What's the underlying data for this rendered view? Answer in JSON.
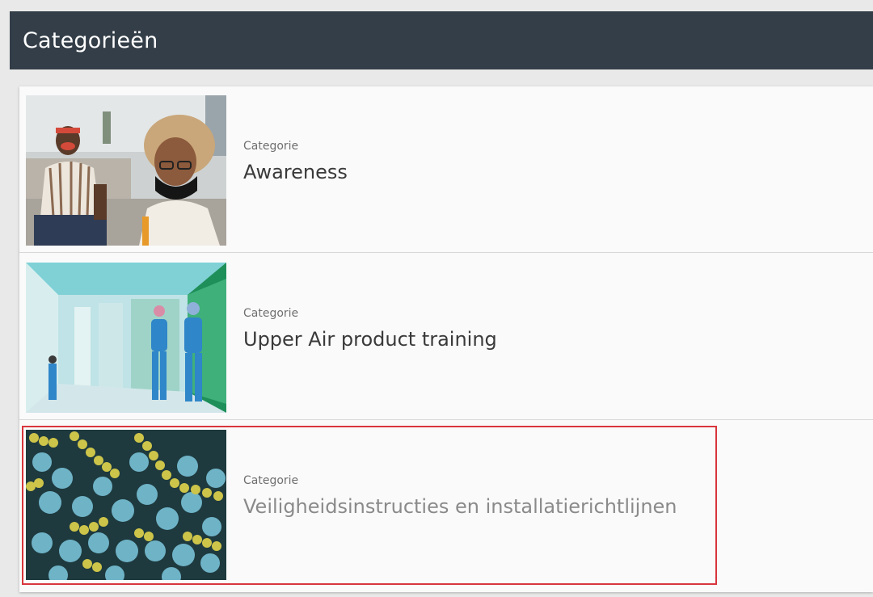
{
  "header": {
    "title": "Categorieën"
  },
  "categories": [
    {
      "kicker": "Categorie",
      "title": "Awareness",
      "image": "people-wearing-masks-photo"
    },
    {
      "kicker": "Categorie",
      "title": "Upper Air product training",
      "image": "hospital-corridor-photo"
    },
    {
      "kicker": "Categorie",
      "title": "Veiligheidsinstructies en installatierichtlijnen",
      "image": "bacteria-microscope-photo"
    }
  ],
  "colors": {
    "header_bg": "#333e48",
    "highlight_border": "#d8353c"
  }
}
